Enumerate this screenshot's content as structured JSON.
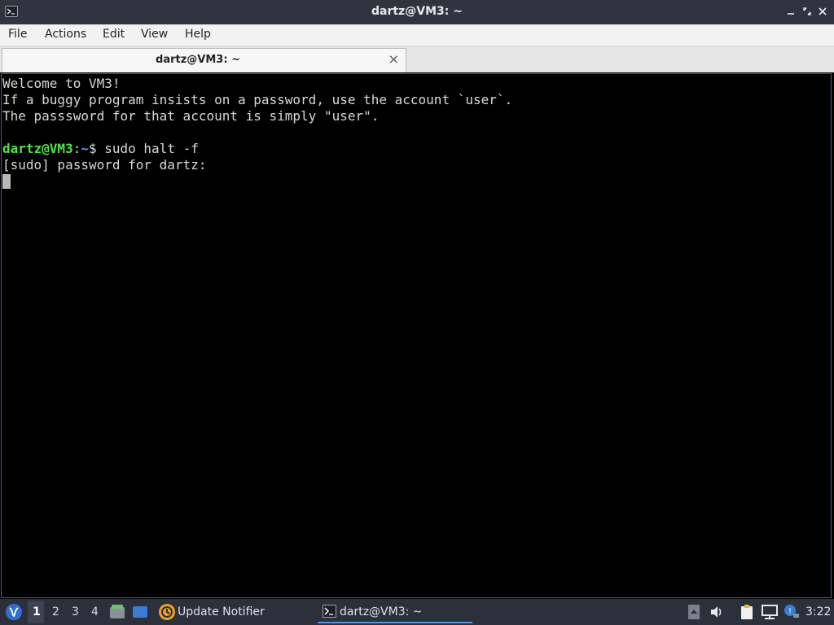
{
  "window": {
    "title": "dartz@VM3: ~",
    "controls": [
      "minimize",
      "maximize",
      "close"
    ]
  },
  "menubar": {
    "items": [
      "File",
      "Actions",
      "Edit",
      "View",
      "Help"
    ]
  },
  "tabs": [
    {
      "label": "dartz@VM3: ~"
    }
  ],
  "terminal": {
    "lines": [
      "Welcome to VM3!",
      "If a buggy program insists on a password, use the account `user`.",
      "The passsword for that account is simply \"user\".",
      ""
    ],
    "prompt": {
      "user_host": "dartz@VM3",
      "sep": ":",
      "path": "~",
      "symbol": "$ "
    },
    "command": "sudo halt -f",
    "output": "[sudo] password for dartz:",
    "colors": {
      "background": "#000000",
      "text": "#d8d8d8",
      "user": "#54e04a",
      "path": "#5a93ff"
    }
  },
  "taskbar": {
    "workspaces": [
      "1",
      "2",
      "3",
      "4"
    ],
    "active_workspace": "1",
    "update_notifier": "Update Notifier",
    "task_label": "dartz@VM3: ~",
    "clock": "3:22",
    "icons": [
      "start-menu-icon",
      "file-manager-icon",
      "desktop-icon",
      "update-notifier-icon",
      "terminal-icon",
      "tray-up-icon",
      "volume-icon",
      "clipboard-icon",
      "network-icon",
      "notification-icon"
    ]
  }
}
